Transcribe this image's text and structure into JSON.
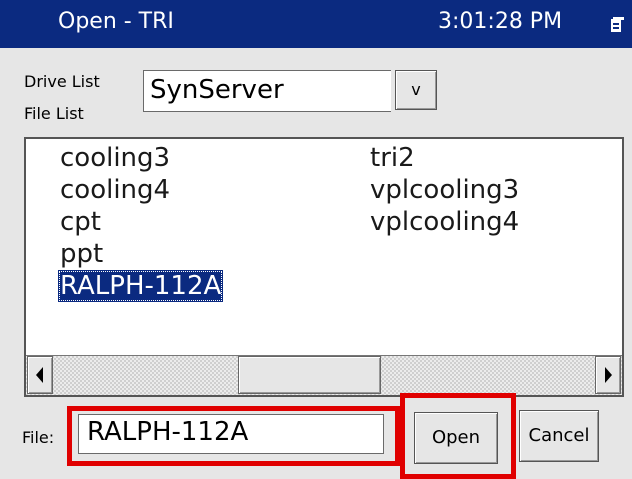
{
  "titlebar": {
    "title": "Open - TRI",
    "clock": "3:01:28 PM",
    "icon": "window-menu-icon"
  },
  "drive": {
    "label": "Drive List",
    "value": "SynServer",
    "dropdown_glyph": "v"
  },
  "file_list": {
    "label": "File List",
    "col1": [
      "cooling3",
      "cooling4",
      "cpt",
      "ppt",
      "RALPH-112A"
    ],
    "col2": [
      "tri2",
      "vplcooling3",
      "vplcooling4"
    ],
    "selected": "RALPH-112A"
  },
  "scrollbar": {
    "left_icon": "arrow-left-icon",
    "right_icon": "arrow-right-icon"
  },
  "file": {
    "label": "File:",
    "value": "RALPH-112A"
  },
  "buttons": {
    "open": "Open",
    "cancel": "Cancel"
  },
  "colors": {
    "title_bg": "#0b2a80",
    "selection": "#0b2a80",
    "highlight": "#e00000"
  }
}
